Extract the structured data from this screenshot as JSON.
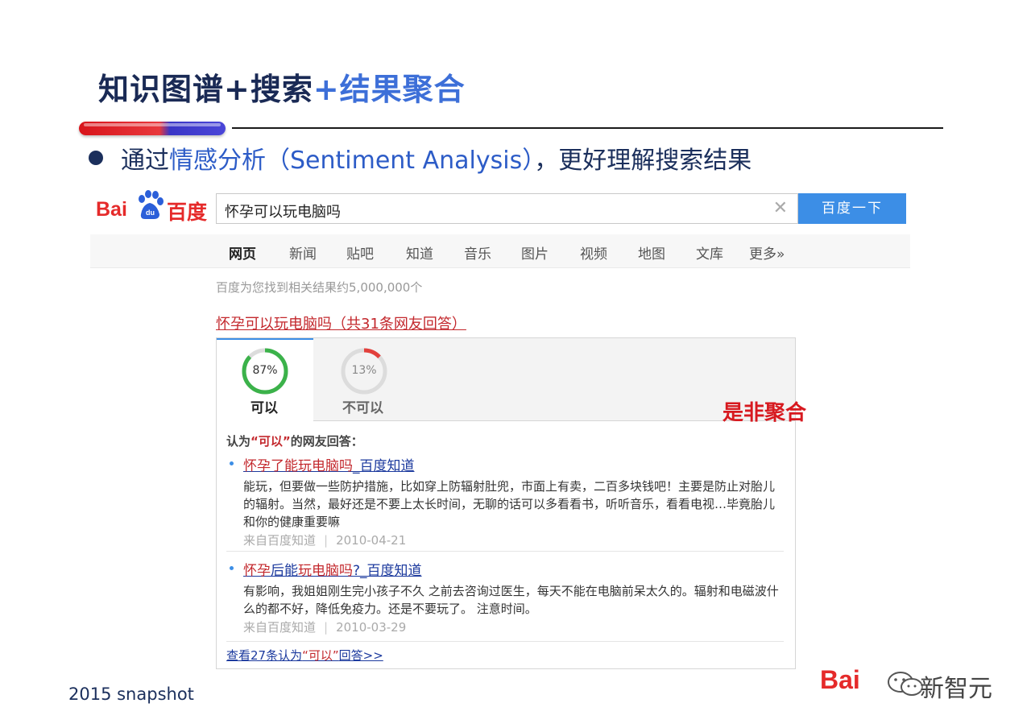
{
  "slide": {
    "title_dark": "知识图谱+搜索",
    "title_blue": "+结果聚合",
    "bullet_prefix": "通过",
    "bullet_highlight": "情感分析（Sentiment Analysis）",
    "bullet_suffix": "，更好理解搜索结果",
    "footer_note": "2015 snapshot",
    "annotation": "是非聚合",
    "colors": {
      "title_dark": "#1a2a55",
      "title_blue": "#3d6fd8",
      "annotation": "#d7191f"
    }
  },
  "search": {
    "logo_bai": "Bai",
    "logo_cn": "百度",
    "query": "怀孕可以玩电脑吗",
    "clear_icon": "close-icon",
    "button_label": "百度一下",
    "accent": "#3c8ee6"
  },
  "nav": {
    "tabs": [
      "网页",
      "新闻",
      "贴吧",
      "知道",
      "音乐",
      "图片",
      "视频",
      "地图",
      "文库",
      "更多»"
    ],
    "active_index": 0
  },
  "results": {
    "count_text": "百度为您找到相关结果约5,000,000个",
    "title": "怀孕可以玩电脑吗（共31条网友回答）"
  },
  "card": {
    "yes": {
      "percent_label": "87%",
      "fraction": 0.87,
      "label": "可以",
      "color": "#3bb24a"
    },
    "no": {
      "percent_label": "13%",
      "fraction": 0.13,
      "label": "不可以",
      "color": "#e2403c"
    },
    "answers_head_prefix": "认为",
    "answers_head_quote": "“可以”",
    "answers_head_suffix": "的网友回答：",
    "answers": [
      {
        "link_red": "怀孕了能玩电脑吗",
        "link_blue": "_百度知道",
        "body": "能玩，但要做一些防护措施，比如穿上防辐射肚兜，市面上有卖，二百多块钱吧！主要是防止对胎儿的辐射。当然，最好还是不要上太长时间，无聊的话可以多看看书，听听音乐，看看电视…毕竟胎儿和你的健康重要嘛",
        "source": "来自百度知道",
        "date": "2010-04-21"
      },
      {
        "link_red_1": "怀孕",
        "link_blue_1": "后能",
        "link_red_2": "玩电脑吗",
        "link_blue_2": "?_百度知道",
        "body": "有影响，我姐姐刚生完小孩子不久 之前去咨询过医生，每天不能在电脑前呆太久的。辐射和电磁波什么的都不好，降低免疫力。还是不要玩了。 注意时间。",
        "source": "来自百度知道",
        "date": "2010-03-29"
      }
    ],
    "more_prefix": "查看27条认为",
    "more_quote": "“可以”",
    "more_suffix": "回答>>"
  },
  "watermark": {
    "bai": "Bai",
    "name": "新智元",
    "icon": "wechat-icon"
  }
}
